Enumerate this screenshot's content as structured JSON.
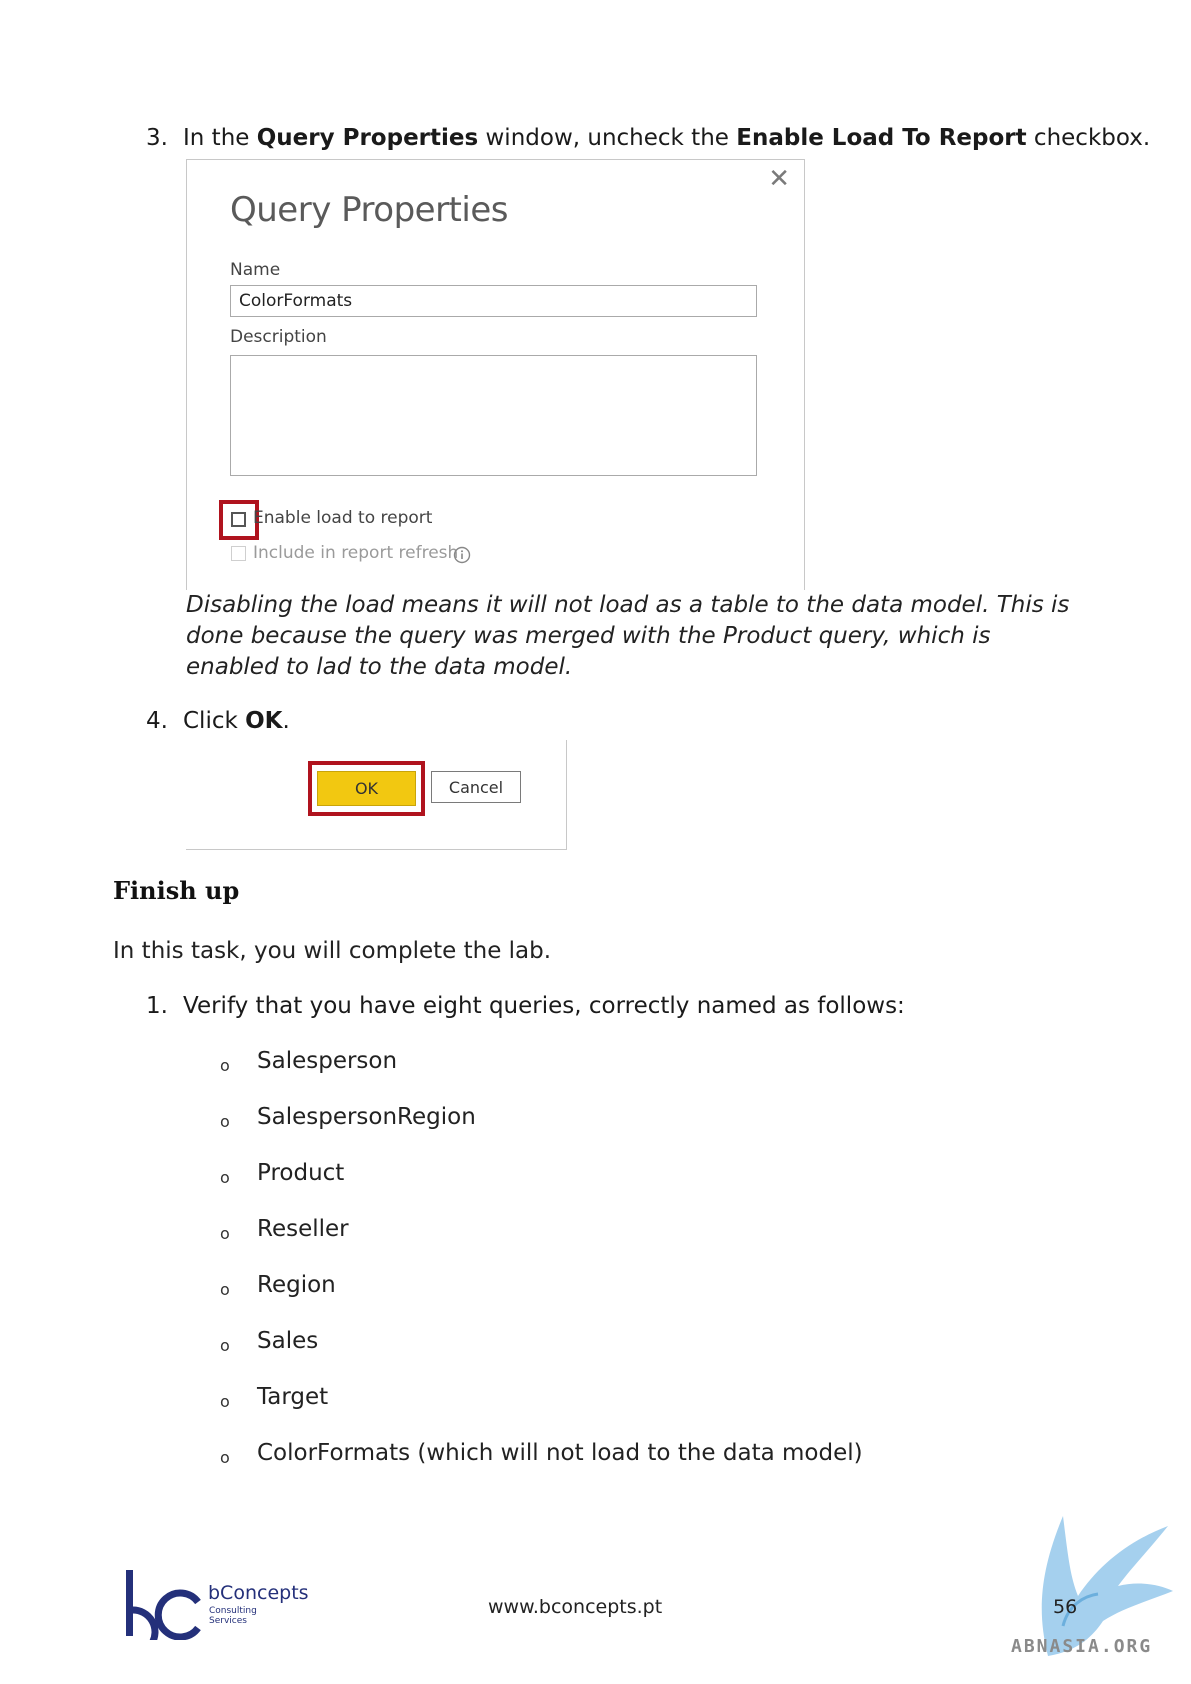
{
  "step3": {
    "num": "3.",
    "pre": "In the ",
    "b1": "Query Properties",
    "mid": " window, uncheck the ",
    "b2": "Enable Load To Report",
    "post": " checkbox."
  },
  "query_properties": {
    "title": "Query Properties",
    "close_glyph": "✕",
    "name_label": "Name",
    "name_value": "ColorFormats",
    "description_label": "Description",
    "description_value": "",
    "enable_load_label": "Enable load to report",
    "enable_load_checked": false,
    "include_refresh_label": "Include in report refresh",
    "info_icon": "info-icon",
    "highlight_color": "#b0131e"
  },
  "note": "Disabling the load means it will not load as a table to the data model. This is done because the query was merged with the Product query, which is enabled to lad to the data model.",
  "step4": {
    "num": "4.",
    "pre": "Click ",
    "b1": "OK",
    "post": "."
  },
  "buttons": {
    "ok": "OK",
    "cancel": "Cancel",
    "ok_color": "#f2c811"
  },
  "finish": {
    "heading": "Finish up",
    "intro": "In this task, you will complete the lab.",
    "step1_num": "1.",
    "step1": "Verify that you have eight queries, correctly named as follows:",
    "bullet_glyph": "o",
    "queries": [
      "Salesperson",
      "SalespersonRegion",
      "Product",
      "Reseller",
      "Region",
      "Sales",
      "Target",
      "ColorFormats (which will not load to the data model)"
    ]
  },
  "footer": {
    "logo_name": "bConcepts",
    "logo_sub1": "Consulting",
    "logo_sub2": "Services",
    "website": "www.bconcepts.pt",
    "page": "56",
    "watermark": "ABNASIA.ORG"
  }
}
